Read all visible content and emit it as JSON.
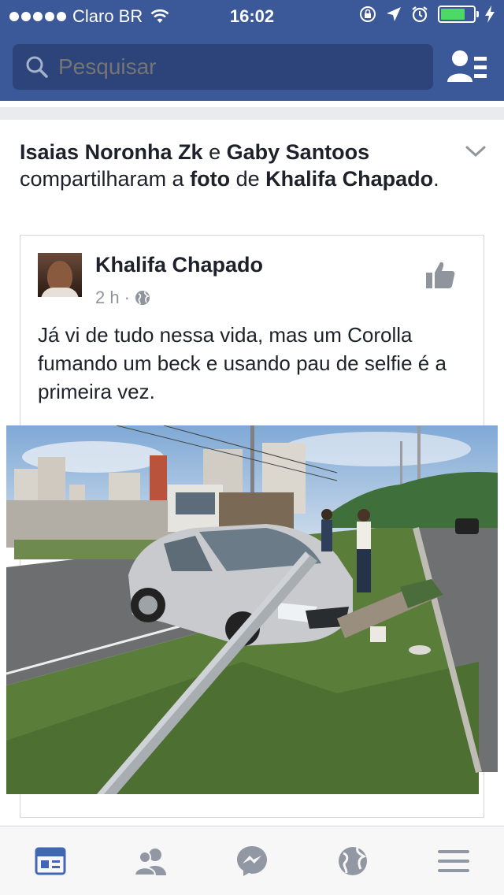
{
  "status_bar": {
    "carrier": "Claro BR",
    "time": "16:02",
    "battery_level": 0.75
  },
  "search": {
    "placeholder": "Pesquisar"
  },
  "story": {
    "header": {
      "actor1": "Isaias Noronha Zk",
      "conj": "e",
      "actor2": "Gaby Santoos",
      "verb": "compartilharam a",
      "object": "foto",
      "prep": "de",
      "owner": "Khalifa Chapado",
      "end": "."
    },
    "shared": {
      "author": "Khalifa Chapado",
      "time": "2 h",
      "separator": "·",
      "text": "Já vi de tudo nessa vida, mas um Corolla fumando um beck e usando pau de selfie é a primeira vez."
    }
  },
  "tabs": [
    {
      "icon": "news-feed-icon",
      "active": true
    },
    {
      "icon": "friend-requests-icon",
      "active": false
    },
    {
      "icon": "messenger-icon",
      "active": false
    },
    {
      "icon": "globe-notifications-icon",
      "active": false
    },
    {
      "icon": "menu-icon",
      "active": false
    }
  ],
  "colors": {
    "brand": "#3b5998",
    "search_bg": "#2c4479",
    "tab_active": "#4267b2",
    "tab_inactive": "#9197a3"
  }
}
